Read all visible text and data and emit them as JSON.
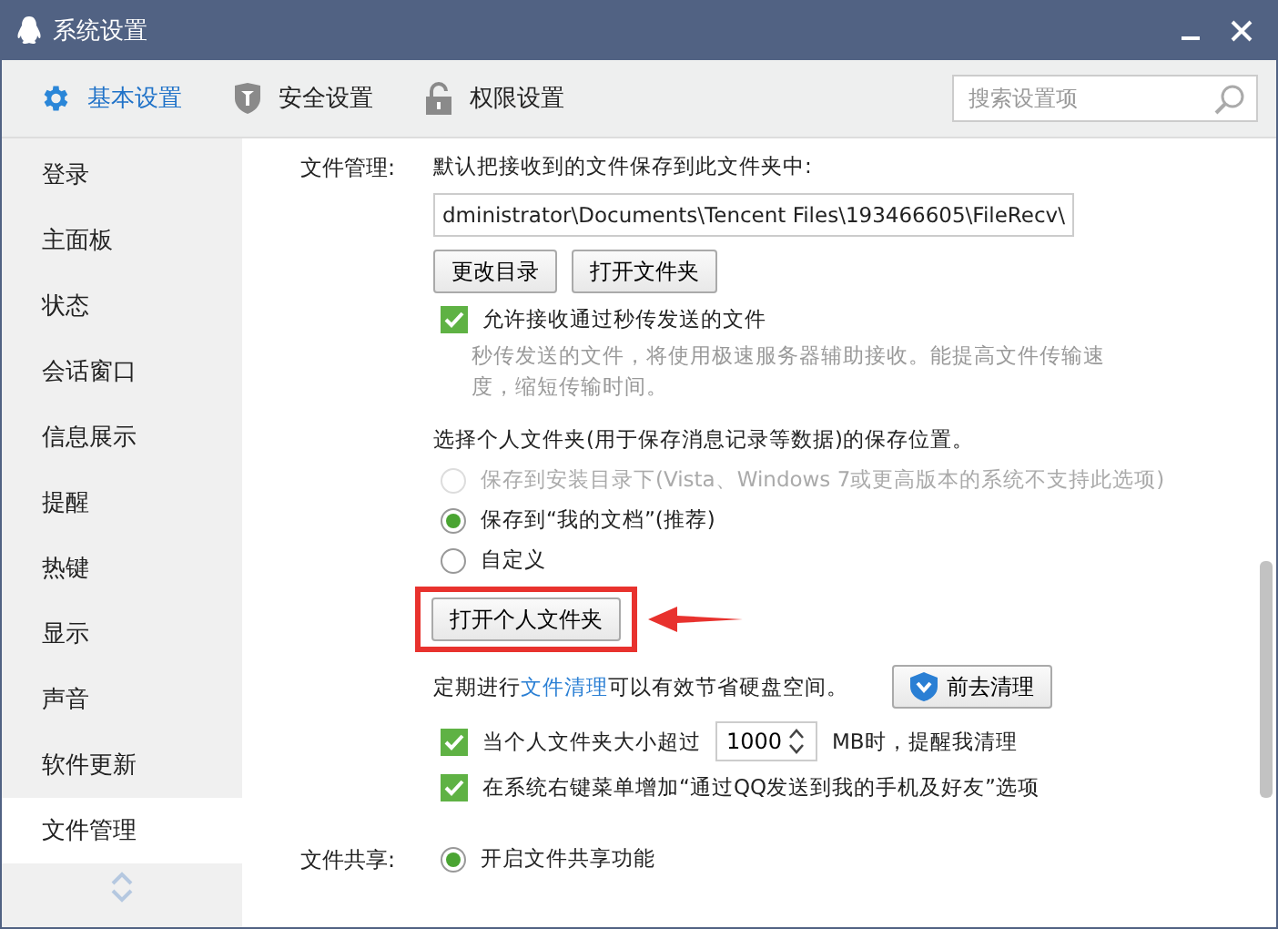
{
  "window": {
    "title": "系统设置"
  },
  "tabs": [
    {
      "label": "基本设置",
      "selected": true,
      "kind": "gear"
    },
    {
      "label": "安全设置",
      "selected": false,
      "kind": "shield"
    },
    {
      "label": "权限设置",
      "selected": false,
      "kind": "lock"
    }
  ],
  "search": {
    "placeholder": "搜索设置项"
  },
  "sidebar": {
    "items": [
      {
        "label": "登录",
        "selected": false
      },
      {
        "label": "主面板",
        "selected": false
      },
      {
        "label": "状态",
        "selected": false
      },
      {
        "label": "会话窗口",
        "selected": false
      },
      {
        "label": "信息展示",
        "selected": false
      },
      {
        "label": "提醒",
        "selected": false
      },
      {
        "label": "热键",
        "selected": false
      },
      {
        "label": "显示",
        "selected": false
      },
      {
        "label": "声音",
        "selected": false
      },
      {
        "label": "软件更新",
        "selected": false
      },
      {
        "label": "文件管理",
        "selected": true
      }
    ]
  },
  "file_management": {
    "label": "文件管理:",
    "intro": "默认把接收到的文件保存到此文件夹中:",
    "path": "dministrator\\Documents\\Tencent Files\\193466605\\FileRecv\\",
    "buttons": [
      "更改目录",
      "打开文件夹"
    ],
    "allow_instant": {
      "checked": true,
      "label": "允许接收通过秒传发送的文件",
      "description": "秒传发送的文件，将使用极速服务器辅助接收。能提高文件传输速度，缩短传输时间。"
    },
    "personal_folder": {
      "prompt": "选择个人文件夹(用于保存消息记录等数据)的保存位置。",
      "options": [
        {
          "label": "保存到安装目录下(Vista、Windows 7或更高版本的系统不支持此选项)",
          "selected": false,
          "disabled": true
        },
        {
          "label": "保存到“我的文档”(推荐)",
          "selected": true,
          "disabled": false
        },
        {
          "label": "自定义",
          "selected": false,
          "disabled": false
        }
      ],
      "open_button": "打开个人文件夹",
      "highlighted": true
    },
    "cleanup": {
      "text_before": "定期进行",
      "link": "文件清理",
      "text_after": "可以有效节省硬盘空间。",
      "button": "前去清理"
    },
    "options": [
      {
        "kind": "size",
        "checked": true,
        "label_before": "当个人文件夹大小超过",
        "value": "1000",
        "label_after": "MB时，提醒我清理"
      },
      {
        "kind": "plain",
        "checked": true,
        "label": "在系统右键菜单增加“通过QQ发送到我的手机及好友”选项"
      }
    ]
  },
  "file_sharing": {
    "label": "文件共享:",
    "options": [
      {
        "label": "开启文件共享功能",
        "selected": true
      }
    ]
  }
}
